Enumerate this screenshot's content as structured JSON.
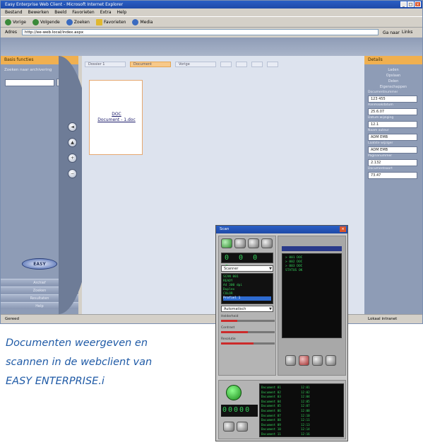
{
  "browser": {
    "title": "Easy Enterprise Web Client - Microsoft Internet Explorer",
    "menu": [
      "Bestand",
      "Bewerken",
      "Beeld",
      "Favorieten",
      "Extra",
      "Help"
    ],
    "toolbar": [
      "Vorige",
      "Volgende",
      "Zoeken",
      "Favorieten",
      "Media"
    ],
    "address_label": "Adres",
    "address_value": "http://ee-web.local/index.aspx",
    "go_label": "Ga naar",
    "links_label": "Links",
    "status_left": "Gereed",
    "status_right": "Lokaal intranet",
    "controls": {
      "min": "_",
      "max": "□",
      "close": "×"
    }
  },
  "left_panel": {
    "title": "Basis functies",
    "search_label": "Zoeken naar archivering",
    "search_button": "»",
    "logo_text": "EASY",
    "nav_items": [
      "Archief",
      "Zoeken",
      "Resultaten",
      "Help"
    ]
  },
  "side_buttons": [
    "◄",
    "▲",
    "+",
    "−"
  ],
  "main": {
    "tabs": [
      "Dossier 1",
      "Document",
      "Vorige",
      "",
      "",
      "",
      ""
    ],
    "document": {
      "line1": "DOC",
      "line2": "Document - 1.doc"
    }
  },
  "right_panel": {
    "title": "Details",
    "links": [
      "Laden",
      "Opslaan",
      "Delen",
      "Eigenschappen"
    ],
    "fields": [
      {
        "label": "Documentnummer",
        "value": "123 455"
      },
      {
        "label": "Aanmaakdatum",
        "value": "25.6.07"
      },
      {
        "label": "Datum wijziging",
        "value": "12.1"
      },
      {
        "label": "Naam auteur",
        "value": "ADM EMB"
      },
      {
        "label": "Laatste wijziger",
        "value": "ADM EMB"
      },
      {
        "label": "Paginanummer",
        "value": "2.132"
      },
      {
        "label": "Documentsoort",
        "value": "73.47"
      }
    ]
  },
  "caption": {
    "lines": [
      "Documenten weergeven en",
      "scannen in de webclient van",
      "EASY ENTERPRISE.i"
    ]
  },
  "scanner": {
    "title": "Scan",
    "close": "×",
    "digits_top": "0 0 0 0",
    "select_value": "Scanner",
    "screen_lines": [
      "SCAN 001",
      "READY",
      "A4 300 dpi",
      "Duplex",
      "COLOR"
    ],
    "highlight_line": "Profiel 1",
    "select2_value": "Automatisch",
    "slider1_label": "Helderheid",
    "slider1_value": 30,
    "slider2_label": "Contrast",
    "slider2_value": 50,
    "slider3_label": "Resolutie",
    "slider3_value": 60,
    "right_lines": [
      "> 001 DOC",
      "> 002 DOC",
      "> 003 DOC",
      "STATUS OK"
    ],
    "digits_bottom": "00000",
    "list": [
      [
        "Document 01",
        "12:01"
      ],
      [
        "Document 02",
        "12:02"
      ],
      [
        "Document 03",
        "12:04"
      ],
      [
        "Document 04",
        "12:05"
      ],
      [
        "Document 05",
        "12:07"
      ],
      [
        "Document 06",
        "12:08"
      ],
      [
        "Document 07",
        "12:10"
      ],
      [
        "Document 08",
        "12:11"
      ],
      [
        "Document 09",
        "12:13"
      ],
      [
        "Document 10",
        "12:14"
      ],
      [
        "Document 11",
        "12:16"
      ]
    ]
  }
}
